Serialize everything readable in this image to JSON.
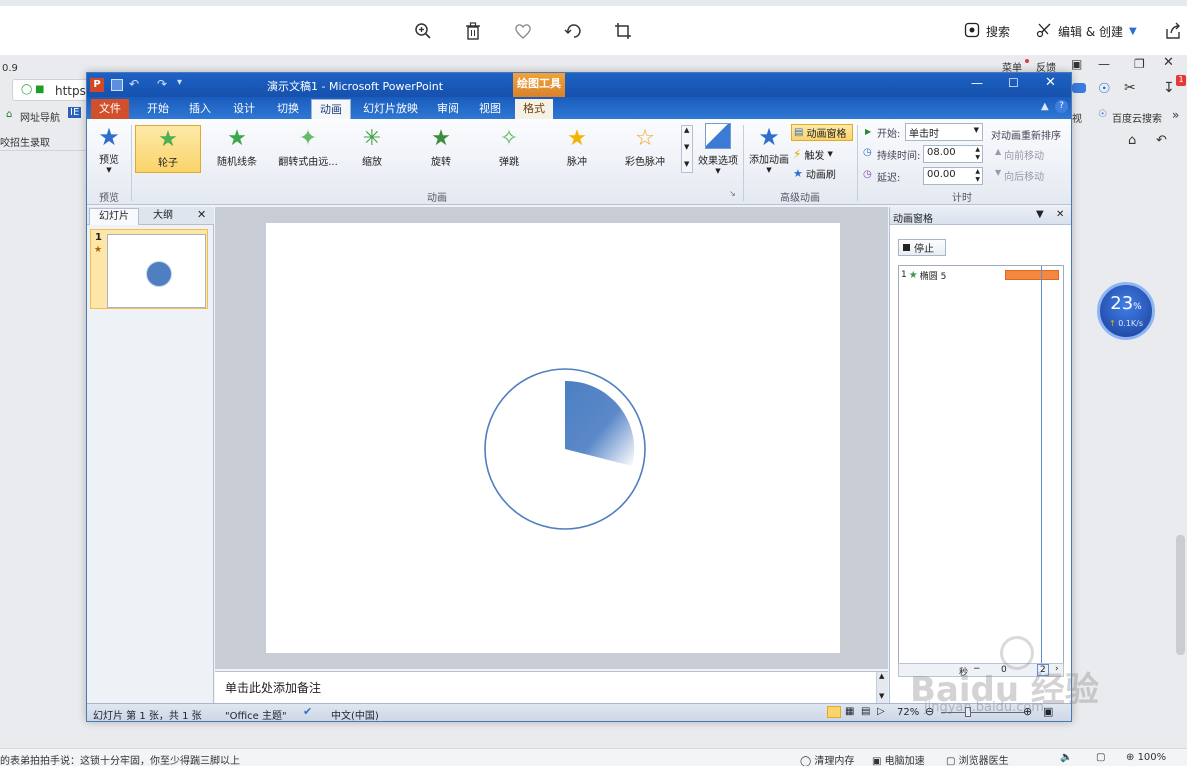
{
  "viewer": {
    "toolbar": {
      "search_label": "搜索",
      "edit_label": "编辑 & 创建"
    }
  },
  "background_browser": {
    "version_text": "0.9",
    "url_fragment": "https",
    "bookmark_nav": "网址导航",
    "left_item": "咬招生录取",
    "right_menu": "菜单",
    "right_feedback": "反馈",
    "right_view": "视",
    "baidu_search": "百度云搜索",
    "status_text": "的表弟拍拍手说：这锁十分牢固，你至少得踹三脚以上",
    "status_items": [
      "清理内存",
      "电脑加速",
      "浏览器医生"
    ],
    "zoom_text": "100%"
  },
  "speed_widget": {
    "percent": "23",
    "unit": "%",
    "speed": "0.1K/s"
  },
  "ppt": {
    "title": "演示文稿1 - Microsoft PowerPoint",
    "context_tool": "绘图工具",
    "tabs": [
      "文件",
      "开始",
      "插入",
      "设计",
      "切换",
      "动画",
      "幻灯片放映",
      "审阅",
      "视图",
      "格式"
    ],
    "active_tab": "动画",
    "ribbon": {
      "preview_label": "预览",
      "preview_group": "预览",
      "animations": [
        {
          "label": "轮子",
          "color": "#4caf50"
        },
        {
          "label": "随机线条",
          "color": "#3aa84a"
        },
        {
          "label": "翻转式由远...",
          "color": "#66bb6a"
        },
        {
          "label": "缩放",
          "color": "#43a047"
        },
        {
          "label": "旋转",
          "color": "#388e3c"
        },
        {
          "label": "弹跳",
          "color": "#5cb85c"
        },
        {
          "label": "脉冲",
          "color": "#f5b301"
        },
        {
          "label": "彩色脉冲",
          "color": "#f0a020"
        }
      ],
      "effect_options": "效果选项",
      "animation_group": "动画",
      "add_animation": "添加动画",
      "animation_pane_btn": "动画窗格",
      "trigger_btn": "触发",
      "animation_painter": "动画刷",
      "advanced_group": "高级动画",
      "start_label": "开始:",
      "start_value": "单击时",
      "duration_label": "持续时间:",
      "duration_value": "08.00",
      "delay_label": "延迟:",
      "delay_value": "00.00",
      "reorder_title": "对动画重新排序",
      "move_earlier": "向前移动",
      "move_later": "向后移动",
      "timing_group": "计时"
    },
    "slides_pane": {
      "tab_slides": "幻灯片",
      "tab_outline": "大纲",
      "slide_number": "1"
    },
    "notes_placeholder": "单击此处添加备注",
    "animation_pane": {
      "title": "动画窗格",
      "stop_button": "停止",
      "item_index": "1",
      "item_name": "椭圆 5",
      "bar_color": "#f58840",
      "seconds_label": "秒",
      "timeline_start": "0",
      "timeline_mark": "2"
    },
    "status": {
      "slide_info": "幻灯片 第 1 张，共 1 张",
      "theme": "\"Office 主题\"",
      "language": "中文(中国)",
      "zoom": "72%"
    }
  },
  "watermark": {
    "brand": "Baidu 经验",
    "url": "jingyan.baidu.com"
  }
}
